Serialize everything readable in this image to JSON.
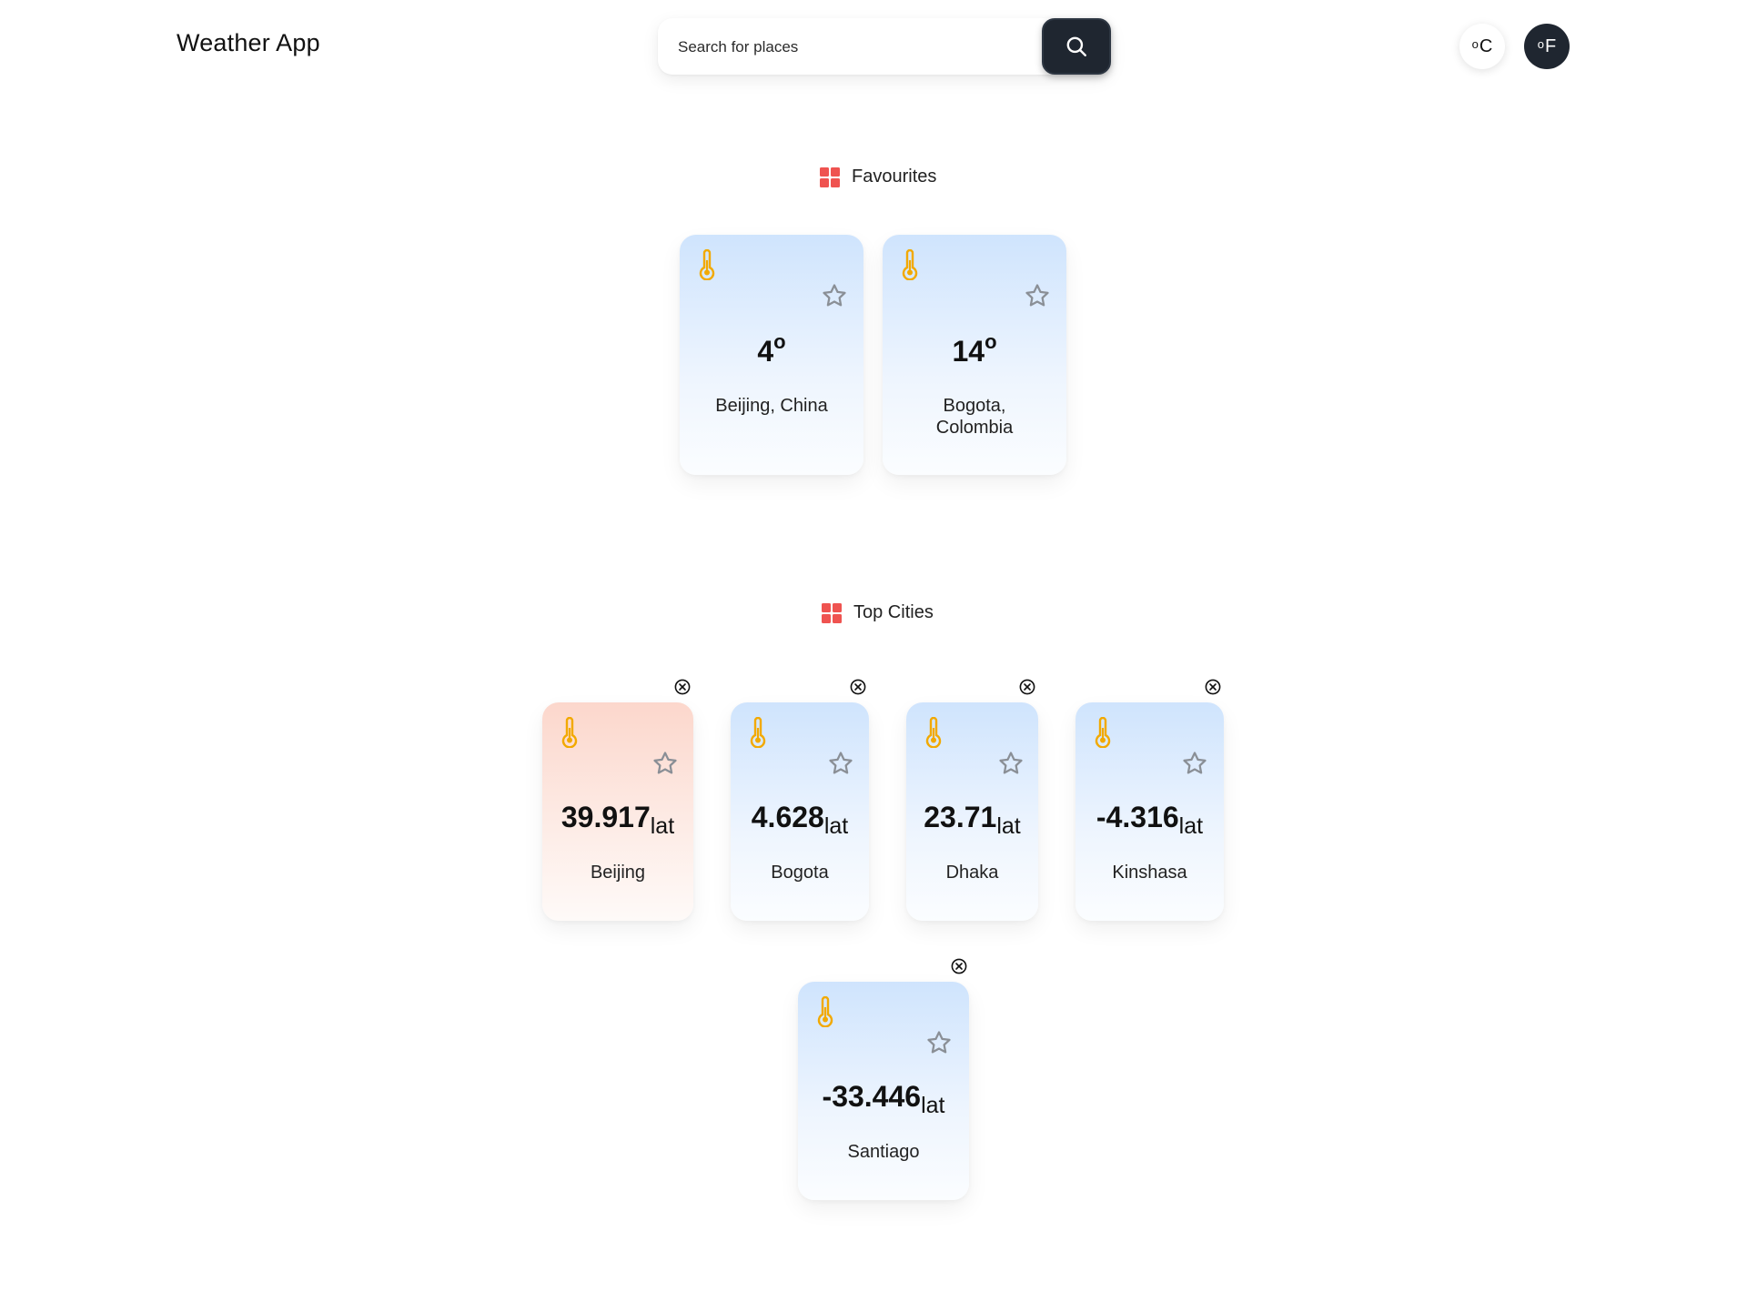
{
  "header": {
    "app_title": "Weather App",
    "search": {
      "placeholder": "Search for places"
    },
    "units": {
      "celsius": "C",
      "fahrenheit": "F",
      "degree_symbol": "o"
    }
  },
  "favourites": {
    "title": "Favourites",
    "cards": [
      {
        "temp": "4",
        "deg": "o",
        "city": "Beijing, China"
      },
      {
        "temp": "14",
        "deg": "o",
        "city_line1": "Bogota,",
        "city_line2": "Colombia"
      }
    ]
  },
  "top_cities": {
    "title": "Top Cities",
    "cards": [
      {
        "value": "39.917",
        "unit": "lat",
        "city": "Beijing",
        "theme": "warm"
      },
      {
        "value": "4.628",
        "unit": "lat",
        "city": "Bogota",
        "theme": "cool"
      },
      {
        "value": "23.71",
        "unit": "lat",
        "city": "Dhaka",
        "theme": "cool"
      },
      {
        "value": "-4.316",
        "unit": "lat",
        "city": "Kinshasa",
        "theme": "cool"
      },
      {
        "value": "-33.446",
        "unit": "lat",
        "city": "Santiago",
        "theme": "cool"
      }
    ]
  },
  "colors": {
    "accent_dark": "#1f2630",
    "icon_red": "#ef5350",
    "thermometer": "#f2a900",
    "star_outline": "#8a8f96"
  }
}
